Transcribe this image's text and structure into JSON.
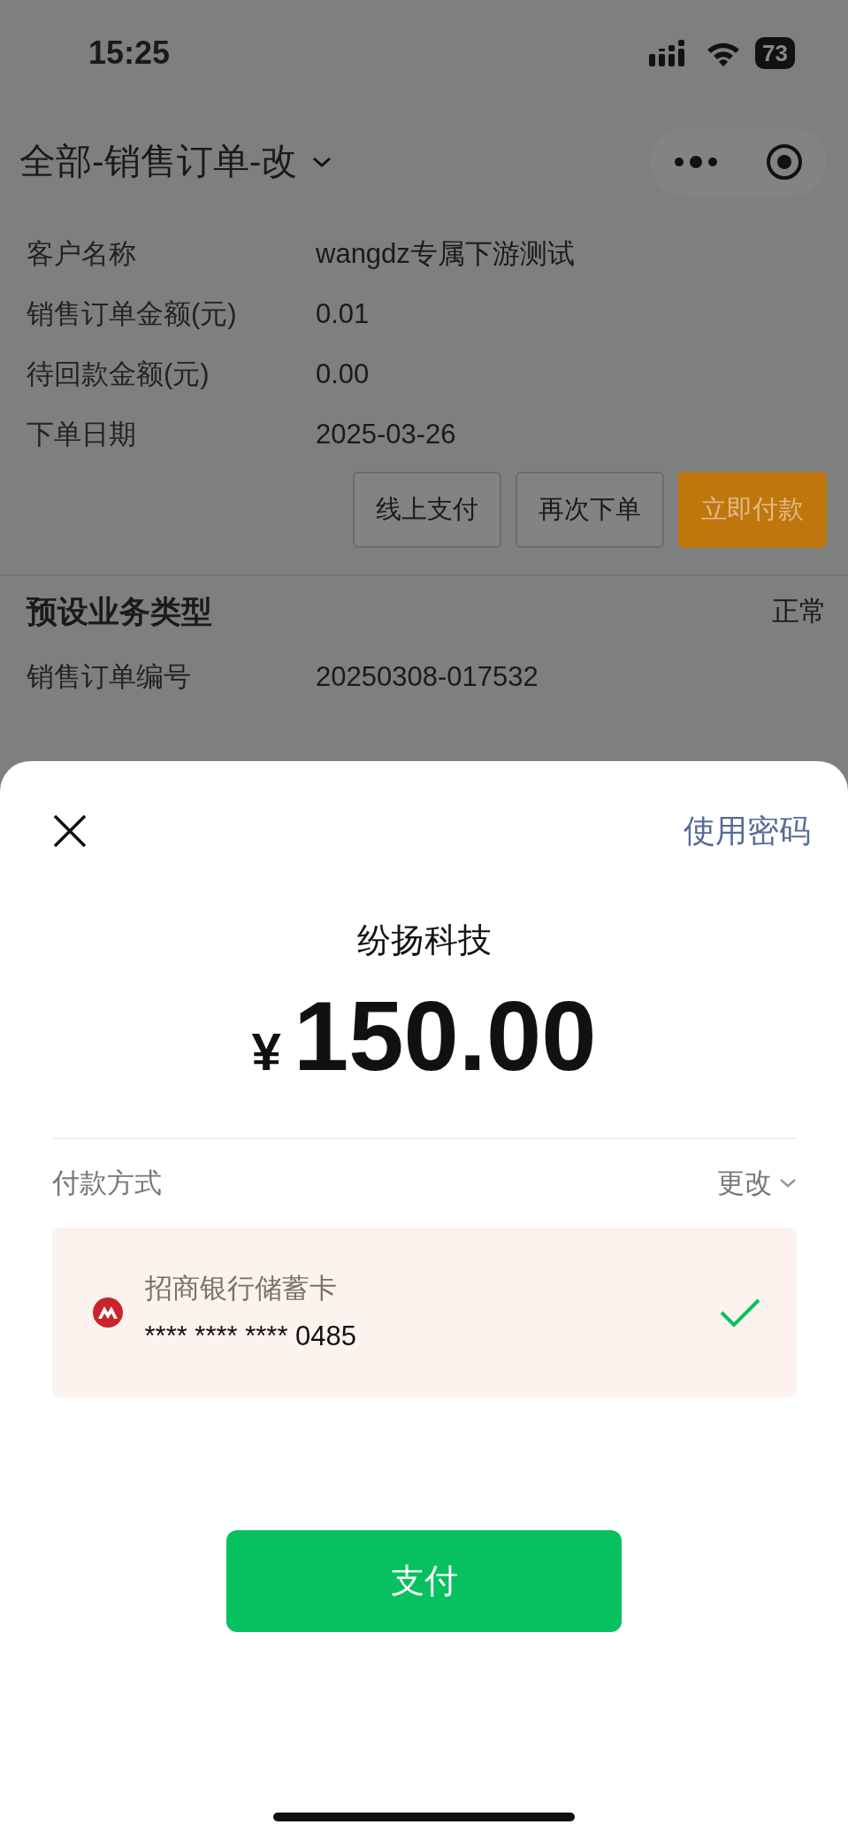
{
  "status_bar": {
    "time": "15:25",
    "battery": "73"
  },
  "header": {
    "title": "全部-销售订单-改"
  },
  "order_summary": {
    "fields": [
      {
        "label": "客户名称",
        "value": "wangdz专属下游测试"
      },
      {
        "label": "销售订单金额(元)",
        "value": "0.01"
      },
      {
        "label": "待回款金额(元)",
        "value": "0.00"
      },
      {
        "label": "下单日期",
        "value": "2025-03-26"
      }
    ],
    "buttons": [
      {
        "label": "线上支付",
        "kind": "outline"
      },
      {
        "label": "再次下单",
        "kind": "outline"
      },
      {
        "label": "立即付款",
        "kind": "primary"
      }
    ]
  },
  "order_detail": {
    "title": "预设业务类型",
    "status": "正常",
    "fields": [
      {
        "label": "销售订单编号",
        "value": "20250308-017532"
      }
    ]
  },
  "payment_sheet": {
    "password_link": "使用密码",
    "payee": "纷扬科技",
    "currency": "¥",
    "amount": "150.00",
    "method_label": "付款方式",
    "change_label": "更改",
    "card": {
      "name": "招商银行储蓄卡",
      "number": "**** **** **** 0485",
      "selected": true
    },
    "pay_button": "支付"
  }
}
